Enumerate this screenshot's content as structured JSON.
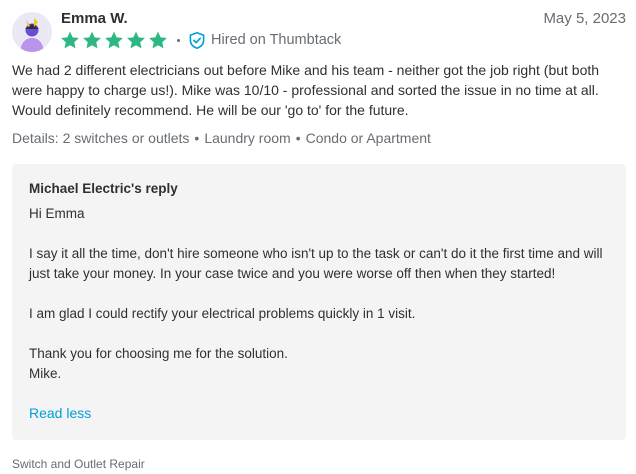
{
  "review": {
    "reviewer_name": "Emma W.",
    "date": "May 5, 2023",
    "rating": 5,
    "rating_max": 5,
    "hired_label": "Hired on Thumbtack",
    "text": "We had 2 different electricians out before Mike and his team - neither got the job right (but both were happy to charge us!). Mike was 10/10 - professional and sorted the issue in no time at all. Would definitely recommend. He will be our 'go to' for the future.",
    "details_prefix": "Details:",
    "details": [
      "2 switches or outlets",
      "Laundry room",
      "Condo or Apartment"
    ]
  },
  "reply": {
    "title": "Michael Electric's reply",
    "lines": [
      "Hi Emma",
      "",
      "I say it all the time, don't hire someone who isn't up to the task or can't do it the first time and will just take your money. In your case twice and you were worse off then when they started!",
      "",
      "I am glad I could rectify your electrical problems quickly in 1 visit.",
      "",
      "Thank you for choosing me for the solution.",
      "Mike."
    ],
    "read_less_label": "Read less"
  },
  "category": "Switch and Outlet Repair",
  "icons": {
    "avatar": "avatar-illustration",
    "star": "star-icon",
    "verified": "shield-check-icon"
  },
  "colors": {
    "star": "#2db783",
    "verified": "#009fd9",
    "link": "#009fd9",
    "reply_bg": "#f4f4f4",
    "text": "#2f3033",
    "muted": "#676d73"
  }
}
